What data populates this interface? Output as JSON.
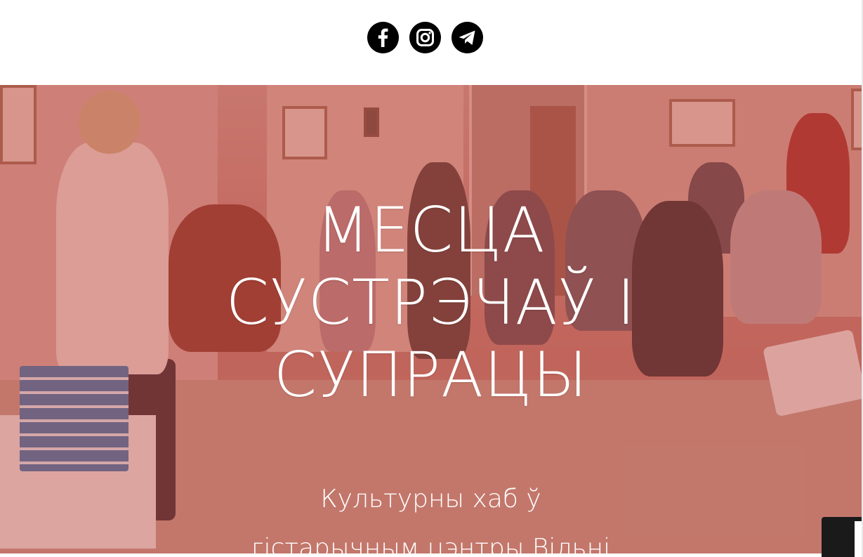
{
  "header": {
    "social_links": [
      {
        "name": "facebook",
        "icon": "facebook-icon"
      },
      {
        "name": "instagram",
        "icon": "instagram-icon"
      },
      {
        "name": "telegram",
        "icon": "telegram-icon"
      }
    ]
  },
  "hero": {
    "title_lines": [
      "МЕСЦА",
      "СУСТРЭЧАЎ І",
      "СУПРАЦЫ"
    ],
    "subtitle_lines": [
      "Культурны хаб ў",
      "гістарычным цэнтры Вільні"
    ],
    "overlay_color": "#be463c"
  }
}
